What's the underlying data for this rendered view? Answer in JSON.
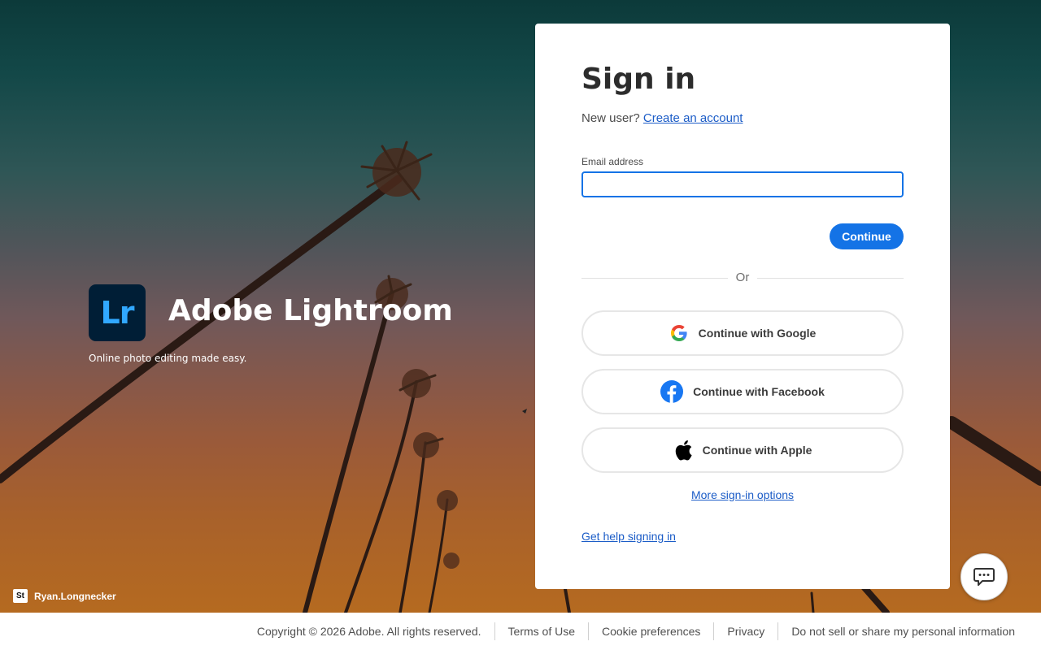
{
  "brand": {
    "logo_letters": "Lr",
    "name": "Adobe Lightroom",
    "tagline": "Online photo editing made easy.",
    "background_credit_badge": "St",
    "background_credit": "Ryan.Longnecker"
  },
  "signin": {
    "title": "Sign in",
    "new_user_text": "New user?",
    "create_account_link": "Create an account",
    "email_label": "Email address",
    "email_value": "",
    "continue_button": "Continue",
    "divider_text": "Or",
    "google_button": "Continue with Google",
    "facebook_button": "Continue with Facebook",
    "apple_button": "Continue with Apple",
    "more_options_link": "More sign-in options",
    "help_link": "Get help signing in"
  },
  "chat": {
    "icon": "chat-bubble-icon"
  },
  "footer": {
    "copyright": "Copyright © 2026 Adobe. All rights reserved.",
    "links": [
      "Terms of Use",
      "Cookie preferences",
      "Privacy",
      "Do not sell or share my personal information"
    ]
  },
  "colors": {
    "accent": "#1473e6",
    "link": "#1b5cc7",
    "lr_tile": "#001e36",
    "lr_letters": "#31a8ff"
  }
}
